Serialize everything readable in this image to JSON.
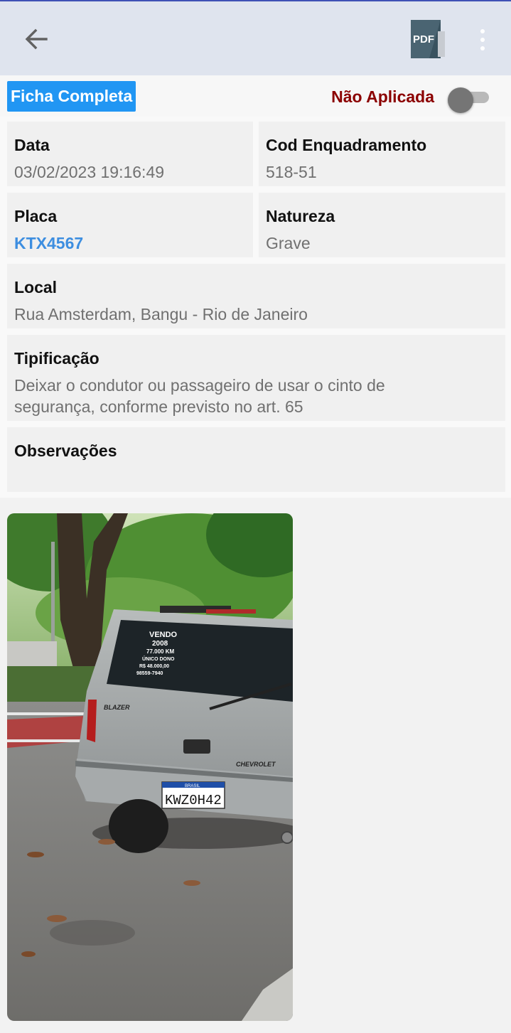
{
  "header": {
    "back_icon": "arrow-left-icon",
    "pdf_icon_text": "PDF",
    "menu_icon": "more-vertical-icon"
  },
  "status": {
    "ficha_label": "Ficha Completa",
    "nao_aplicada_label": "Não Aplicada",
    "toggle_on": false
  },
  "details": {
    "data": {
      "label": "Data",
      "value": "03/02/2023 19:16:49"
    },
    "cod": {
      "label": "Cod Enquadramento",
      "value": "518-51"
    },
    "placa": {
      "label": "Placa",
      "value": "KTX4567"
    },
    "natureza": {
      "label": "Natureza",
      "value": "Grave"
    },
    "local": {
      "label": "Local",
      "value": "Rua Amsterdam, Bangu - Rio de Janeiro"
    },
    "tipificacao": {
      "label": "Tipificação",
      "value": "Deixar o condutor ou passageiro de usar o cinto de segurança, conforme previsto no art. 65"
    },
    "observacoes": {
      "label": "Observações",
      "value": ""
    }
  },
  "photo": {
    "sign_lines": [
      "VENDO",
      "2008",
      "77.000 KM",
      "ÚNICO DONO",
      "R$ 48.000,00",
      "98559-7940"
    ],
    "plate_country": "BRASIL",
    "plate_text": "KWZ0H42",
    "badge_text": "BLAZER",
    "brand_text": "CHEVROLET"
  },
  "colors": {
    "accent": "#2196f3",
    "topbar": "#dfe4ee",
    "status_red": "#8b0000",
    "link_blue": "#3d8ee0"
  }
}
